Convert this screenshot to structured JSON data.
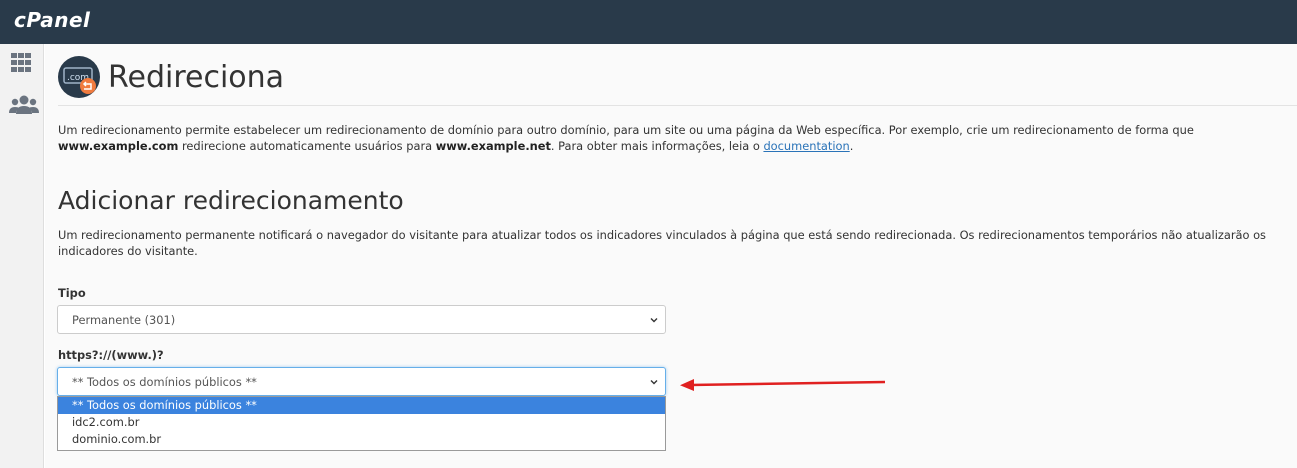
{
  "app": {
    "logo": "cPanel"
  },
  "sidebar": {
    "items": [
      {
        "icon": "grid-icon"
      },
      {
        "icon": "users-icon"
      }
    ]
  },
  "page": {
    "icon_text": ".com",
    "title": "Redireciona",
    "intro": {
      "p1": "Um redirecionamento permite estabelecer um redirecionamento de domínio para outro domínio, para um site ou uma página da Web específica. Por exemplo, crie um redirecionamento de forma que",
      "bold1": "www.example.com",
      "p2": " redirecione automaticamente usuários para ",
      "bold2": "www.example.net",
      "p3": ". Para obter mais informações, leia o ",
      "link": "documentation",
      "p4": "."
    }
  },
  "section": {
    "title": "Adicionar redirecionamento",
    "description": "Um redirecionamento permanente notificará o navegador do visitante para atualizar todos os indicadores vinculados à página que está sendo redirecionada. Os redirecionamentos temporários não atualizarão os indicadores do visitante."
  },
  "form": {
    "type_label": "Tipo",
    "type_value": "Permanente (301)",
    "domain_label": "https?://(www.)?",
    "domain_value": "** Todos os domínios públicos **",
    "domain_options": [
      "** Todos os domínios públicos **",
      "idc2.com.br",
      "dominio.com.br"
    ]
  },
  "colors": {
    "topbar": "#293a4a",
    "selected_option": "#3b83de",
    "annotation_arrow": "#e02020",
    "link": "#2a73b8"
  }
}
